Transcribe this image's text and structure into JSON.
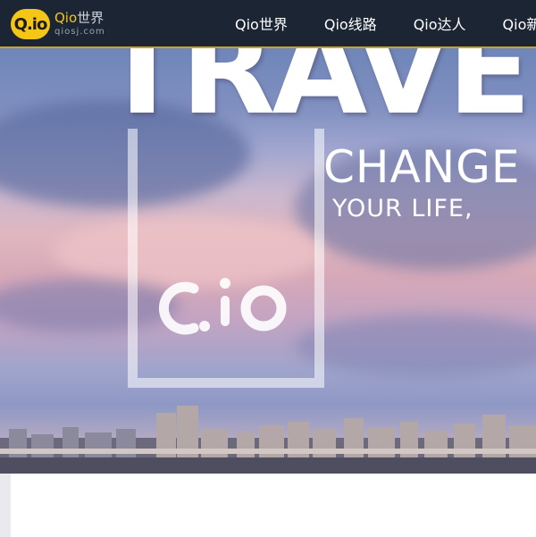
{
  "header": {
    "logo": {
      "badge": "Q.io",
      "title_brand": "Qio",
      "title_cn": "世界",
      "url": "qiosj.com"
    },
    "nav": [
      {
        "label": "Qio世界"
      },
      {
        "label": "Qio线路"
      },
      {
        "label": "Qio达人"
      },
      {
        "label": "Qio新"
      }
    ]
  },
  "hero": {
    "headline": "TRAVEL",
    "subline": "CHANGE",
    "tagline": "YOUR LIFE,",
    "watermark": "Q.io"
  },
  "colors": {
    "header_bg": "#1c2534",
    "accent": "#f5c518",
    "nav_text": "#ffffff"
  }
}
